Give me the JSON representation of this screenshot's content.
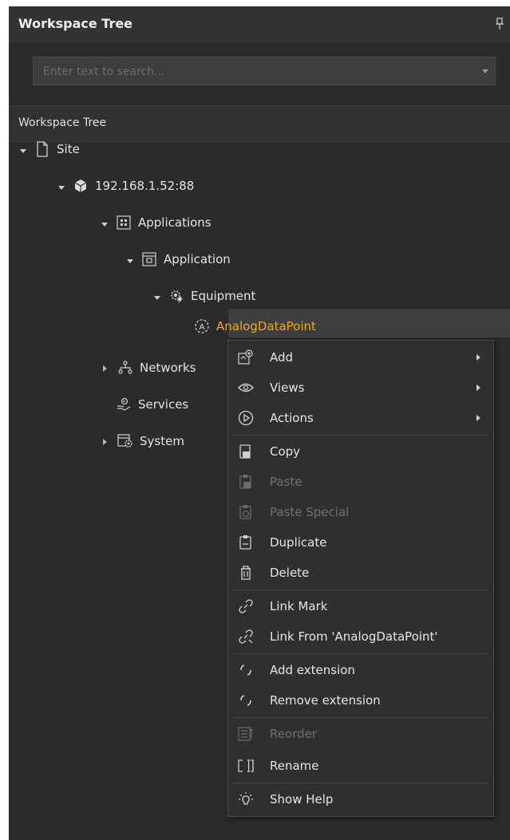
{
  "panel": {
    "title": "Workspace Tree",
    "search_placeholder": "Enter text to search...",
    "header": "Workspace Tree"
  },
  "tree": {
    "site": "Site",
    "host": "192.168.1.52:88",
    "applications": "Applications",
    "application": "Application",
    "equipment": "Equipment",
    "datapoint": "AnalogDataPoint",
    "networks": "Networks",
    "services": "Services",
    "system": "System"
  },
  "context_menu": {
    "items": [
      {
        "label": "Add",
        "icon": "add-icon",
        "submenu": true,
        "enabled": true
      },
      {
        "label": "Views",
        "icon": "eye-icon",
        "submenu": true,
        "enabled": true
      },
      {
        "label": "Actions",
        "icon": "play-circle-icon",
        "submenu": true,
        "enabled": true
      },
      {
        "label": "Copy",
        "icon": "copy-icon",
        "submenu": false,
        "enabled": true
      },
      {
        "label": "Paste",
        "icon": "paste-icon",
        "submenu": false,
        "enabled": false
      },
      {
        "label": "Paste Special",
        "icon": "paste-special-icon",
        "submenu": false,
        "enabled": false
      },
      {
        "label": "Duplicate",
        "icon": "duplicate-icon",
        "submenu": false,
        "enabled": true
      },
      {
        "label": "Delete",
        "icon": "trash-icon",
        "submenu": false,
        "enabled": true
      },
      {
        "label": "Link Mark",
        "icon": "link-icon",
        "submenu": false,
        "enabled": true
      },
      {
        "label": "Link From 'AnalogDataPoint'",
        "icon": "link-from-icon",
        "submenu": false,
        "enabled": true
      },
      {
        "label": "Add extension",
        "icon": "extension-add-icon",
        "submenu": false,
        "enabled": true
      },
      {
        "label": "Remove extension",
        "icon": "extension-remove-icon",
        "submenu": false,
        "enabled": true
      },
      {
        "label": "Reorder",
        "icon": "reorder-icon",
        "submenu": false,
        "enabled": false
      },
      {
        "label": "Rename",
        "icon": "rename-icon",
        "submenu": false,
        "enabled": true
      },
      {
        "label": "Show Help",
        "icon": "help-bulb-icon",
        "submenu": false,
        "enabled": true
      }
    ]
  },
  "colors": {
    "panel_bg": "#2b2b2b",
    "selected_text": "#f5a623",
    "disabled_text": "#707070"
  }
}
